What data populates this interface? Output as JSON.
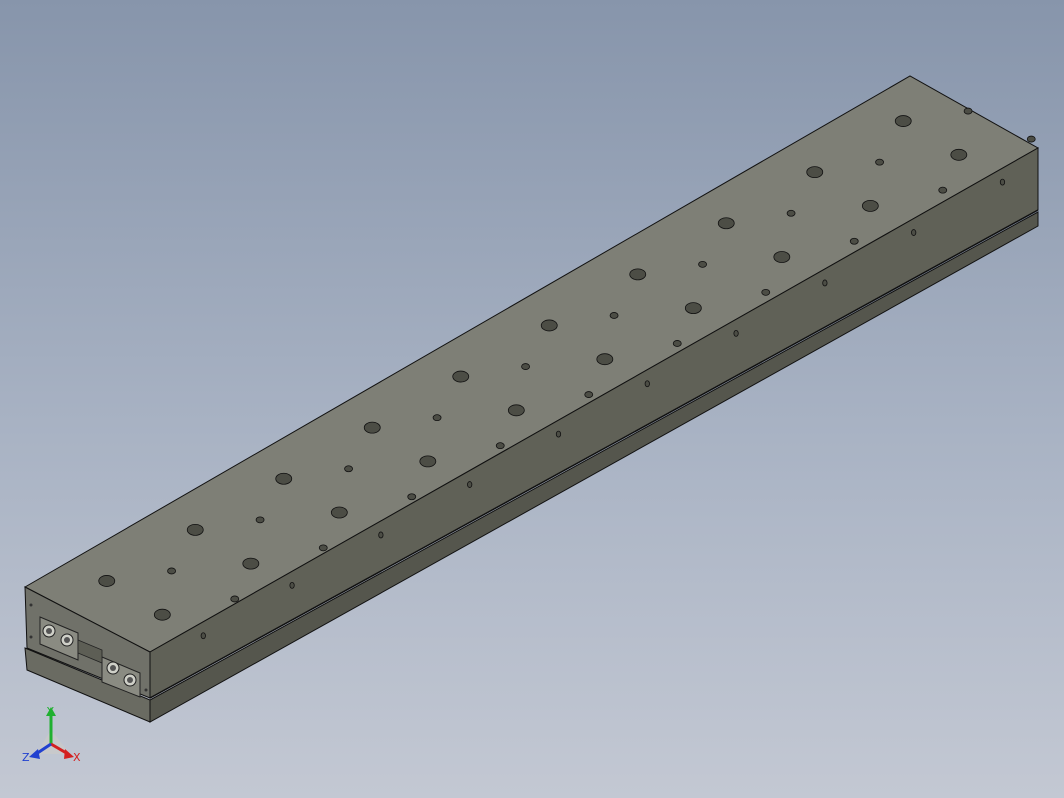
{
  "viewport": {
    "background_top": "#8795ab",
    "background_bottom": "#c3c8d3"
  },
  "part": {
    "top_color": "#7e7f76",
    "front_color": "#606157",
    "end_color": "#707169",
    "edge_color": "#111111",
    "hole_color": "#4c4d45"
  },
  "triad": {
    "x_label": "X",
    "y_label": "Y",
    "z_label": "Z",
    "x_color": "#d42020",
    "y_color": "#20b030",
    "z_color": "#2040d0"
  }
}
